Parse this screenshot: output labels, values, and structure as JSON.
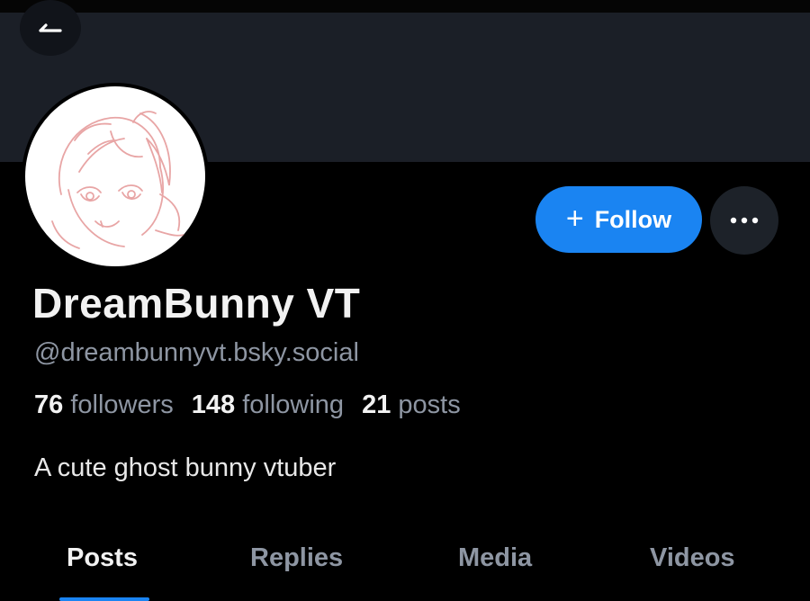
{
  "profile": {
    "display_name": "DreamBunny VT",
    "handle": "@dreambunnyvt.bsky.social",
    "bio": "A cute ghost bunny vtuber"
  },
  "stats": {
    "followers_count": "76",
    "followers_label": "followers",
    "following_count": "148",
    "following_label": "following",
    "posts_count": "21",
    "posts_label": "posts"
  },
  "actions": {
    "follow_icon": "+",
    "follow_label": "Follow",
    "more_icon": "ellipsis-icon",
    "back_icon": "arrow-left-icon"
  },
  "tabs": [
    {
      "label": "Posts",
      "active": true
    },
    {
      "label": "Replies",
      "active": false
    },
    {
      "label": "Media",
      "active": false
    },
    {
      "label": "Videos",
      "active": false
    }
  ],
  "colors": {
    "accent": "#1a84f2",
    "background": "#000000",
    "banner": "#1b1f27",
    "muted_text": "#8e96a3"
  }
}
